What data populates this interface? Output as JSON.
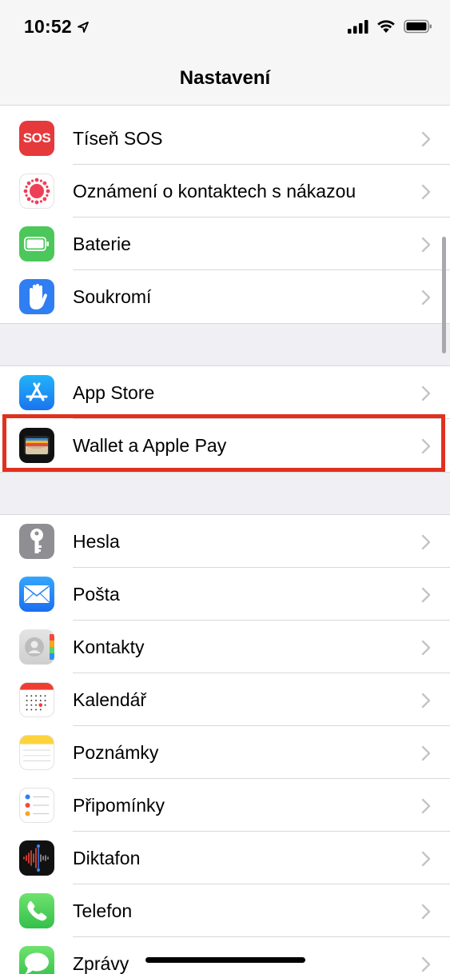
{
  "status_bar": {
    "time": "10:52"
  },
  "nav": {
    "title": "Nastavení"
  },
  "groups": [
    {
      "items": [
        {
          "label": "Tíseň SOS",
          "icon": "sos-icon",
          "icon_text": "SOS",
          "color": "#e5393b"
        },
        {
          "label": "Oznámení o kontaktech s nákazou",
          "icon": "exposure-notification-icon",
          "color": "#ffffff"
        },
        {
          "label": "Baterie",
          "icon": "battery-icon",
          "color": "#4cc75a"
        },
        {
          "label": "Soukromí",
          "icon": "hand-icon",
          "color": "#2f7ef2"
        }
      ]
    },
    {
      "items": [
        {
          "label": "App Store",
          "icon": "app-store-icon",
          "color": "#1f8cf5"
        },
        {
          "label": "Wallet a Apple Pay",
          "icon": "wallet-icon",
          "color": "#111111"
        }
      ]
    },
    {
      "items": [
        {
          "label": "Hesla",
          "icon": "key-icon",
          "color": "#8e8e93"
        },
        {
          "label": "Pošta",
          "icon": "mail-icon",
          "color": "#2e8ff5"
        },
        {
          "label": "Kontakty",
          "icon": "contacts-icon",
          "color": "#d9d9d9"
        },
        {
          "label": "Kalendář",
          "icon": "calendar-icon",
          "color": "#ffffff"
        },
        {
          "label": "Poznámky",
          "icon": "notes-icon",
          "color": "#ffffff"
        },
        {
          "label": "Připomínky",
          "icon": "reminders-icon",
          "color": "#ffffff"
        },
        {
          "label": "Diktafon",
          "icon": "voice-memos-icon",
          "color": "#111111"
        },
        {
          "label": "Telefon",
          "icon": "phone-icon",
          "color": "#4cd964"
        },
        {
          "label": "Zprávy",
          "icon": "messages-icon",
          "color": "#4cd964"
        }
      ]
    }
  ],
  "highlight_color": "#e0311f"
}
